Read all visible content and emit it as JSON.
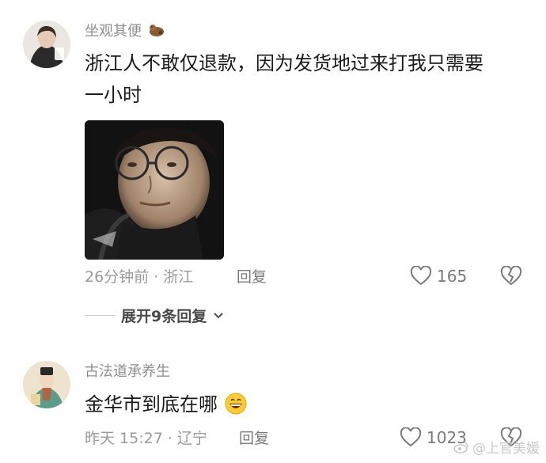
{
  "comments": [
    {
      "username": "坐观其便",
      "badge_icon": "otter-emoji",
      "content_line1": "浙江人不敢仅退款，因为发货地过来打我只需要",
      "content_line2": "一小时",
      "sticker": "face-with-glasses-sticker",
      "meta": "26分钟前 · 浙江",
      "reply_label": "回复",
      "like_count": "165",
      "expand_label": "展开9条回复"
    },
    {
      "username": "古法道承养生",
      "content": "金华市到底在哪",
      "emoji": "grinning-face-emoji",
      "meta": "昨天 15:27 · 辽宁",
      "reply_label": "回复",
      "like_count": "1023"
    }
  ],
  "watermark": "@上官美媛"
}
